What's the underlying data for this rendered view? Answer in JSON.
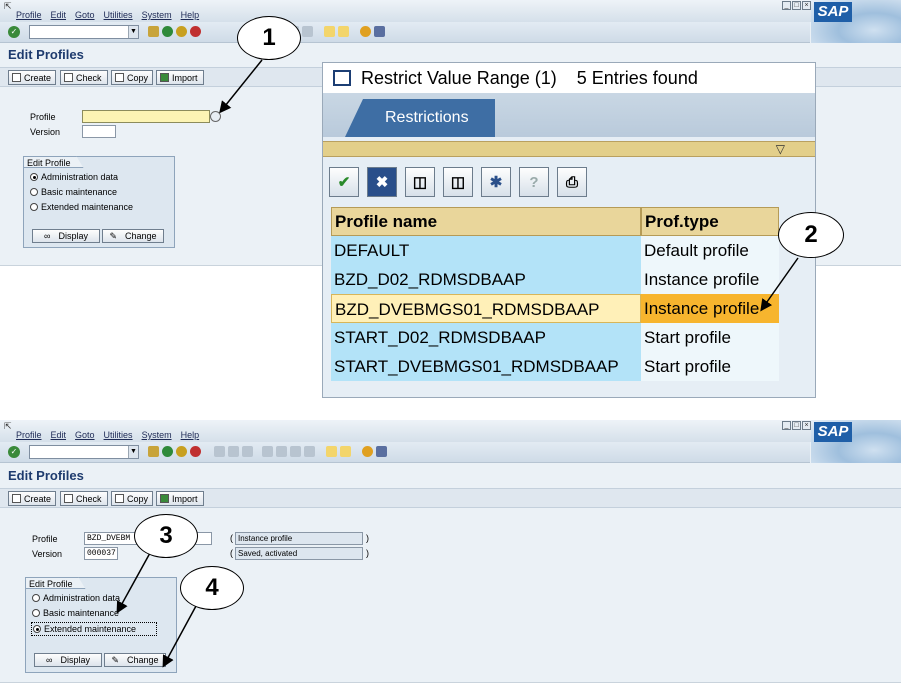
{
  "screen_top": {
    "menu": [
      "Profile",
      "Edit",
      "Goto",
      "Utilities",
      "System",
      "Help"
    ],
    "title": "Edit Profiles",
    "buttons": {
      "create": "Create",
      "check": "Check",
      "copy": "Copy",
      "import": "Import"
    },
    "profile_label": "Profile",
    "version_label": "Version",
    "profile_value": "",
    "version_value": "",
    "group_title": "Edit Profile",
    "radios": [
      "Administration data",
      "Basic maintenance",
      "Extended maintenance"
    ],
    "display_label": "Display",
    "change_label": "Change"
  },
  "popup": {
    "title": "Restrict Value Range (1)",
    "entries": "5 Entries found",
    "tab": "Restrictions",
    "filter_icon": "funnel-icon",
    "headers": [
      "Profile name",
      "Prof.type"
    ],
    "rows": [
      [
        "DEFAULT",
        "Default profile"
      ],
      [
        "BZD_D02_RDMSDBAAP",
        "Instance profile"
      ],
      [
        "BZD_DVEBMGS01_RDMSDBAAP",
        "Instance profile"
      ],
      [
        "START_D02_RDMSDBAAP",
        "Start profile"
      ],
      [
        "START_DVEBMGS01_RDMSDBAAP",
        "Start profile"
      ]
    ],
    "selected_row": 2
  },
  "screen_bottom": {
    "menu": [
      "Profile",
      "Edit",
      "Goto",
      "Utilities",
      "System",
      "Help"
    ],
    "title": "Edit Profiles",
    "buttons": {
      "create": "Create",
      "check": "Check",
      "copy": "Copy",
      "import": "Import"
    },
    "profile_label": "Profile",
    "version_label": "Version",
    "profile_value": "BZD_DVEBM",
    "version_value": "000037",
    "profile_type": "Instance profile",
    "version_status": "Saved, activated",
    "paren_open": "(",
    "paren_close": ")",
    "group_title": "Edit Profile",
    "radios": [
      "Administration data",
      "Basic maintenance",
      "Extended maintenance"
    ],
    "selected_radio": 2,
    "display_label": "Display",
    "change_label": "Change"
  },
  "callouts": [
    "1",
    "2",
    "3",
    "4"
  ],
  "logo": "SAP",
  "colors": {
    "accent": "#1e3b6e",
    "highlight": "#f7b52e",
    "table_blue": "#b3e3f8",
    "header_gold": "#e9d69b"
  }
}
